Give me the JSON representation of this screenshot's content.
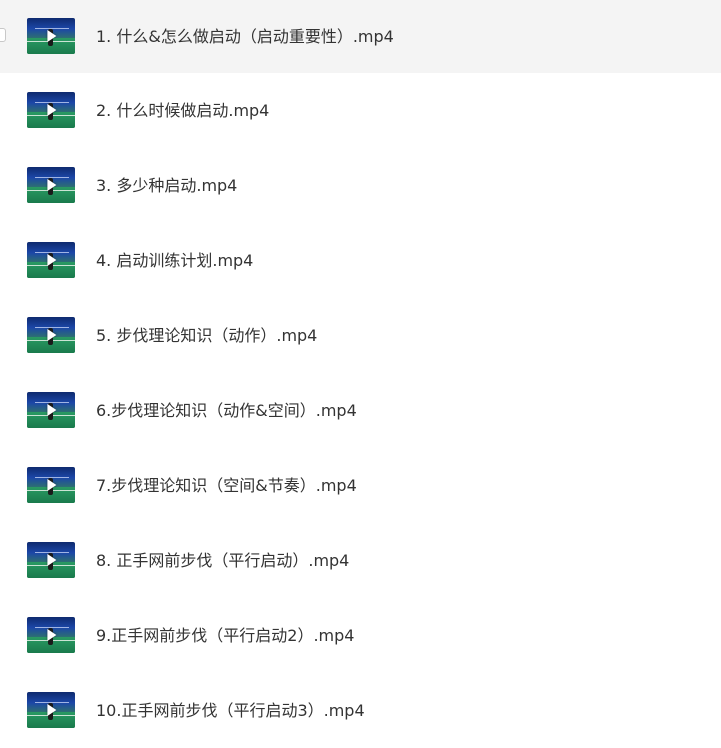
{
  "files": [
    {
      "name": "1. 什么&怎么做启动（启动重要性）.mp4",
      "thumb_icon": "video-thumbnail-icon"
    },
    {
      "name": "2. 什么时候做启动.mp4",
      "thumb_icon": "video-thumbnail-icon"
    },
    {
      "name": "3. 多少种启动.mp4",
      "thumb_icon": "video-thumbnail-icon"
    },
    {
      "name": "4. 启动训练计划.mp4",
      "thumb_icon": "video-thumbnail-icon"
    },
    {
      "name": "5. 步伐理论知识（动作）.mp4",
      "thumb_icon": "video-thumbnail-icon"
    },
    {
      "name": "6.步伐理论知识（动作&空间）.mp4",
      "thumb_icon": "video-thumbnail-icon"
    },
    {
      "name": "7.步伐理论知识（空间&节奏）.mp4",
      "thumb_icon": "video-thumbnail-icon"
    },
    {
      "name": "8. 正手网前步伐（平行启动）.mp4",
      "thumb_icon": "video-thumbnail-icon"
    },
    {
      "name": "9.正手网前步伐（平行启动2）.mp4",
      "thumb_icon": "video-thumbnail-icon"
    },
    {
      "name": "10.正手网前步伐（平行启动3）.mp4",
      "thumb_icon": "video-thumbnail-icon"
    }
  ],
  "colors": {
    "row_highlight": "#f4f4f4",
    "text": "#333333"
  }
}
